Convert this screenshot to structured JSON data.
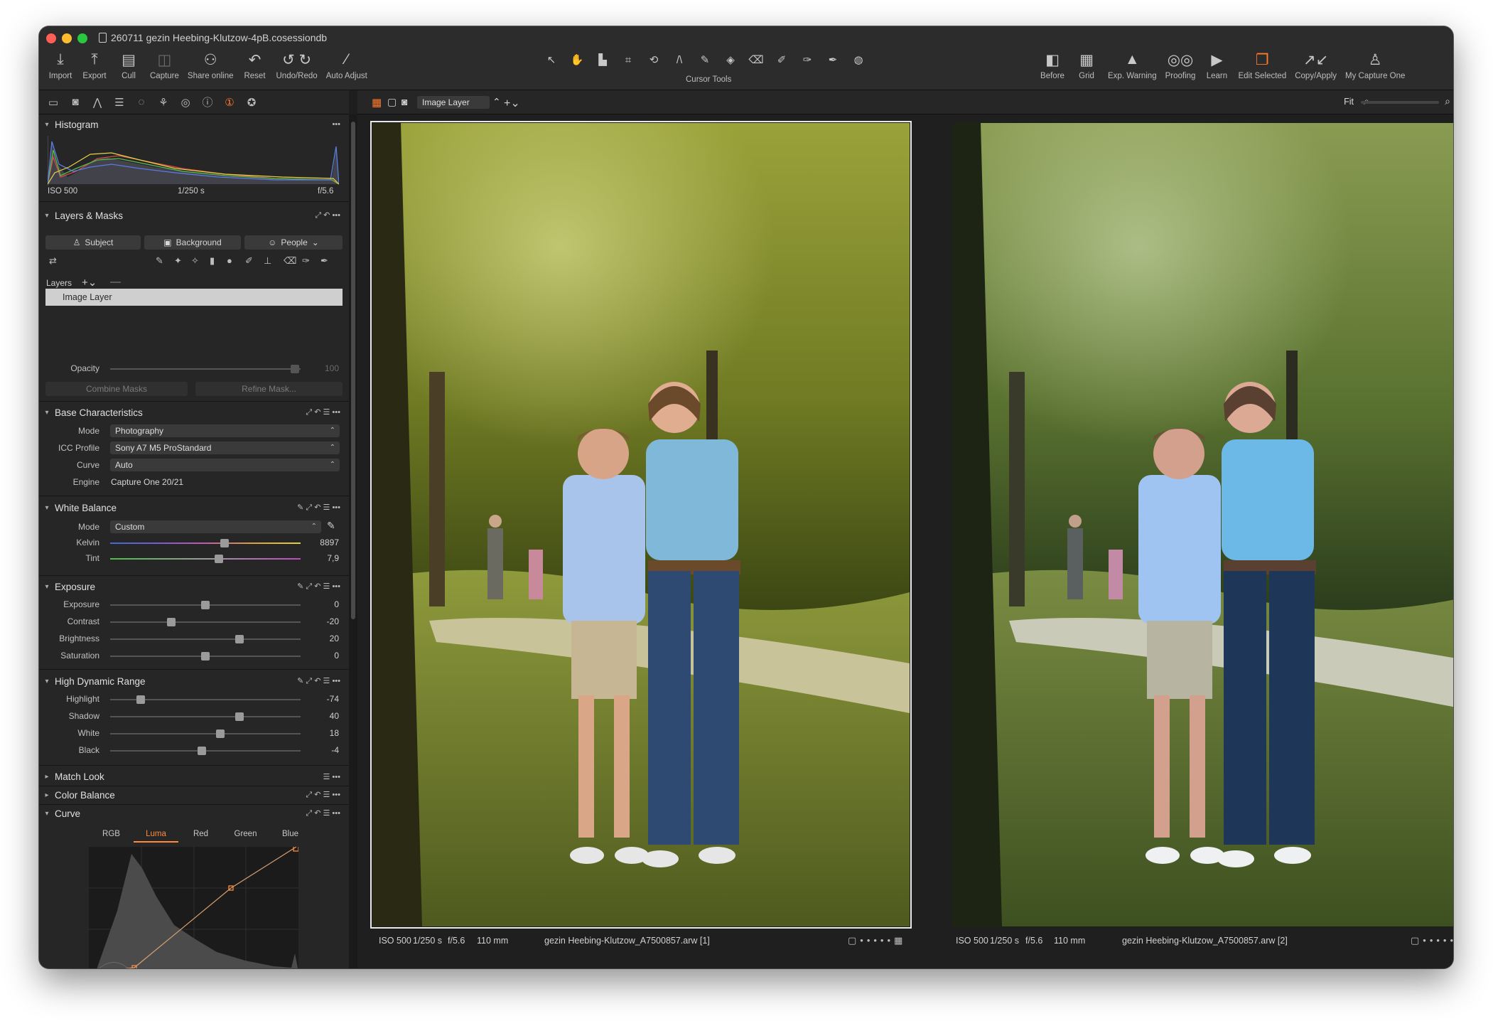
{
  "window": {
    "title": "260711 gezin Heebing-Klutzow-4pB.cosessiondb"
  },
  "toolbar": {
    "left": [
      {
        "label": "Import",
        "icon": "import-icon"
      },
      {
        "label": "Export",
        "icon": "export-icon"
      },
      {
        "label": "Cull",
        "icon": "cull-icon"
      },
      {
        "label": "Capture",
        "icon": "capture-icon"
      },
      {
        "label": "Share online",
        "icon": "share-online-icon"
      },
      {
        "label": "Reset",
        "icon": "reset-icon"
      },
      {
        "label": "Undo/Redo",
        "icon": "undo-redo-icon"
      },
      {
        "label": "Auto Adjust",
        "icon": "auto-adjust-icon"
      }
    ],
    "cursor_tools_label": "Cursor Tools",
    "right": [
      {
        "label": "Before",
        "icon": "before-icon"
      },
      {
        "label": "Grid",
        "icon": "grid-icon"
      },
      {
        "label": "Exp. Warning",
        "icon": "exposure-warning-icon"
      },
      {
        "label": "Proofing",
        "icon": "proofing-icon"
      },
      {
        "label": "Learn",
        "icon": "learn-icon"
      },
      {
        "label": "Edit Selected",
        "icon": "edit-selected-icon"
      },
      {
        "label": "Copy/Apply",
        "icon": "copy-apply-icon"
      },
      {
        "label": "My Capture One",
        "icon": "my-capture-one-icon"
      }
    ]
  },
  "histogram": {
    "title": "Histogram",
    "iso": "ISO 500",
    "shutter": "1/250 s",
    "aperture": "f/5.6"
  },
  "layers_masks": {
    "title": "Layers & Masks",
    "buttons": [
      "Subject",
      "Background",
      "People"
    ],
    "layers_label": "Layers",
    "layer_name": "Image Layer",
    "opacity_label": "Opacity",
    "opacity_value": "100",
    "combine_masks": "Combine Masks",
    "refine_mask": "Refine Mask..."
  },
  "base_characteristics": {
    "title": "Base Characteristics",
    "rows": [
      {
        "label": "Mode",
        "value": "Photography"
      },
      {
        "label": "ICC Profile",
        "value": "Sony A7 M5 ProStandard"
      },
      {
        "label": "Curve",
        "value": "Auto"
      }
    ],
    "engine_label": "Engine",
    "engine_value": "Capture One 20/21"
  },
  "white_balance": {
    "title": "White Balance",
    "mode_label": "Mode",
    "mode_value": "Custom",
    "sliders": [
      {
        "label": "Kelvin",
        "value": "8897",
        "pos": 0.6
      },
      {
        "label": "Tint",
        "value": "7,9",
        "pos": 0.57
      }
    ]
  },
  "exposure": {
    "title": "Exposure",
    "sliders": [
      {
        "label": "Exposure",
        "value": "0",
        "pos": 0.5
      },
      {
        "label": "Contrast",
        "value": "-20",
        "pos": 0.32
      },
      {
        "label": "Brightness",
        "value": "20",
        "pos": 0.68
      },
      {
        "label": "Saturation",
        "value": "0",
        "pos": 0.5
      }
    ]
  },
  "hdr": {
    "title": "High Dynamic Range",
    "sliders": [
      {
        "label": "Highlight",
        "value": "-74",
        "pos": 0.16
      },
      {
        "label": "Shadow",
        "value": "40",
        "pos": 0.68
      },
      {
        "label": "White",
        "value": "18",
        "pos": 0.58
      },
      {
        "label": "Black",
        "value": "-4",
        "pos": 0.48
      }
    ]
  },
  "collapsed_sections": [
    "Match Look",
    "Color Balance"
  ],
  "curve": {
    "title": "Curve",
    "tabs": [
      "RGB",
      "Luma",
      "Red",
      "Green",
      "Blue"
    ],
    "active_tab": "Luma"
  },
  "viewer": {
    "layer_select": "Image Layer",
    "zoom_label": "Fit",
    "left_caption": {
      "iso": "ISO 500",
      "shutter": "1/250 s",
      "aperture": "f/5.6",
      "focal": "110 mm",
      "filename": "gezin Heebing-Klutzow_A7500857.arw [1]"
    },
    "right_caption": {
      "iso": "ISO 500",
      "shutter": "1/250 s",
      "aperture": "f/5.6",
      "focal": "110 mm",
      "filename": "gezin Heebing-Klutzow_A7500857.arw [2]"
    }
  },
  "colors": {
    "accent": "#ff7b2a",
    "panel": "#262626",
    "window": "#1e1e1e"
  }
}
